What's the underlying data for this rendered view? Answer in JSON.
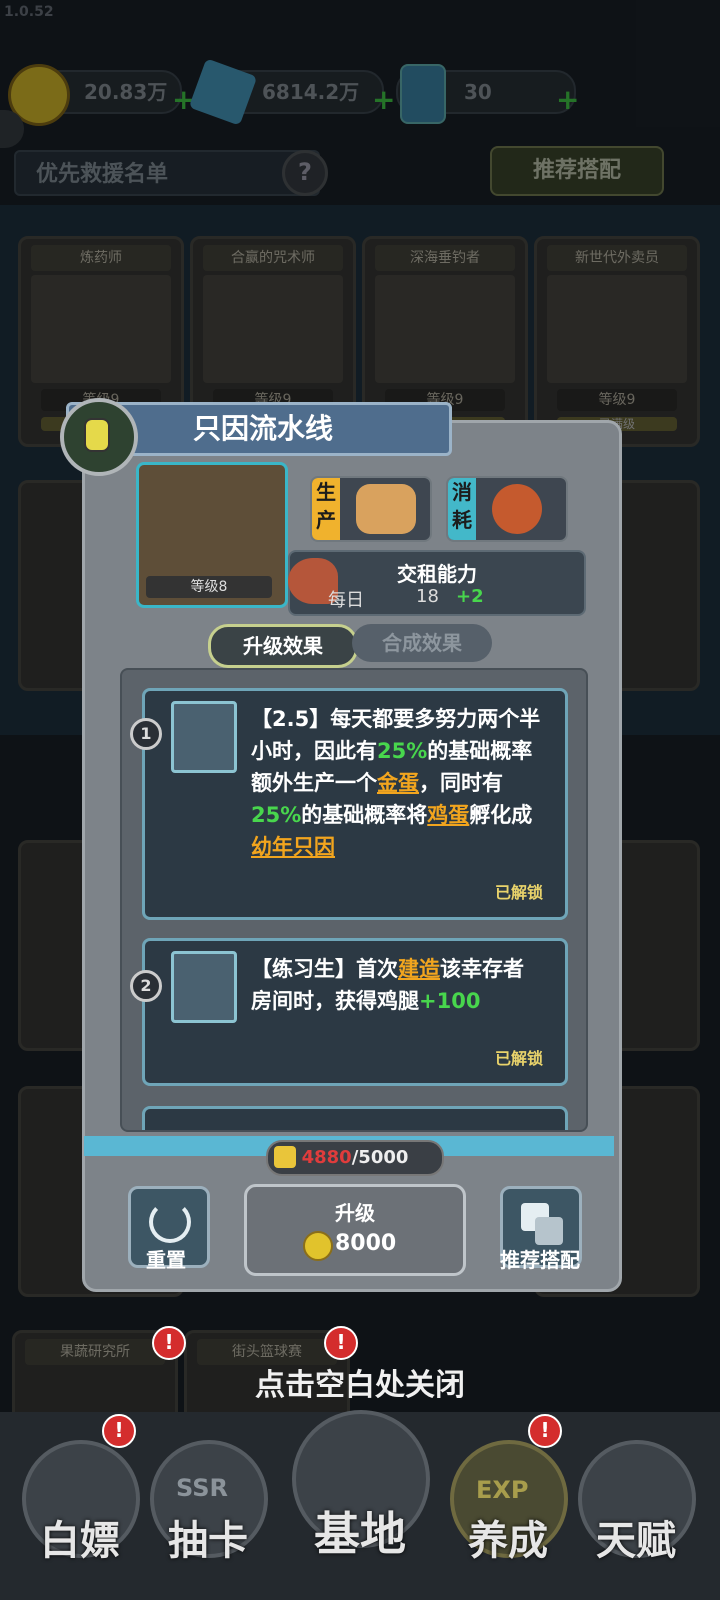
{
  "version": "1.0.52",
  "resources": {
    "coin": "20.83万",
    "crystal": "6814.2万",
    "energy": "30"
  },
  "header": {
    "rescue_list": "优先救援名单",
    "help": "?",
    "recommend": "推荐搭配"
  },
  "background_cards": [
    {
      "name": "炼药师",
      "level": "等级9"
    },
    {
      "name": "合赢的咒术师",
      "level": "等级9"
    },
    {
      "name": "深海垂钓者",
      "level": "等级9"
    },
    {
      "name": "新世代外卖员",
      "level": "等级9",
      "sub": "已满级"
    }
  ],
  "modal": {
    "title": "只因流水线",
    "portrait_level": "等级8",
    "produce_tag": "生产",
    "consume_tag": "消耗",
    "rent": {
      "title": "交租能力",
      "period": "每日",
      "value": "18",
      "bonus": "+2"
    },
    "tabs": {
      "active": "升级效果",
      "inactive": "合成效果"
    },
    "effects": [
      {
        "num": "1",
        "text_a": "【2.5】每天都要多努力两个半小时，因此有",
        "pct1": "25%",
        "text_b": "的基础概率额外生产一个",
        "link1": "金蛋",
        "text_c": "，同时有",
        "pct2": "25%",
        "text_d": "的基础概率将",
        "link2": "鸡蛋",
        "text_e": "孵化成",
        "link3": "幼年只因",
        "status": "已解锁"
      },
      {
        "num": "2",
        "text_a": "【练习生】首次",
        "link1": "建造",
        "text_b": "该幸存者房间时，获得鸡腿",
        "bonus": "+100",
        "status": "已解锁"
      }
    ],
    "pieces_current": "4880",
    "pieces_total": "/5000",
    "reset": "重置",
    "upgrade": "升级",
    "upgrade_cost": "8000",
    "recommend": "推荐搭配"
  },
  "close_hint": "点击空白处关闭",
  "bottom_cards": [
    {
      "name": "果蔬研究所"
    },
    {
      "name": "街头篮球赛"
    }
  ],
  "nav": [
    {
      "label": "白嫖"
    },
    {
      "label": "抽卡",
      "icon_text": "SSR"
    },
    {
      "label": "基地"
    },
    {
      "label": "养成",
      "icon_text": "EXP"
    },
    {
      "label": "天赋"
    }
  ],
  "colors": {
    "green": "#48d64d",
    "orange": "#f2a51e",
    "accent_cyan": "#3ab6c8",
    "unlocked": "#e9d36b"
  }
}
